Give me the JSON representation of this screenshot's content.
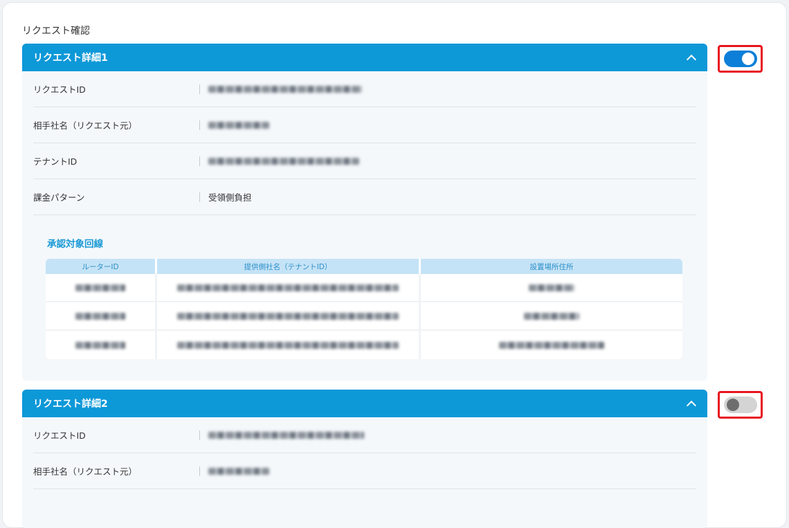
{
  "page": {
    "title": "リクエスト確認"
  },
  "requests": [
    {
      "header": "リクエスト詳細1",
      "toggle_on": true,
      "fields": [
        {
          "label": "リクエストID",
          "value": ""
        },
        {
          "label": "相手社名（リクエスト元）",
          "value": ""
        },
        {
          "label": "テナントID",
          "value": ""
        },
        {
          "label": "課金パターン",
          "value": "受領側負担"
        }
      ],
      "lines_title": "承認対象回線",
      "table": {
        "headers": [
          "ルーターID",
          "提供側社名（テナントID）",
          "設置場所住所"
        ],
        "rows": [
          [
            "",
            "",
            ""
          ],
          [
            "",
            "",
            ""
          ],
          [
            "",
            "",
            ""
          ]
        ]
      }
    },
    {
      "header": "リクエスト詳細2",
      "toggle_on": false,
      "fields": [
        {
          "label": "リクエストID",
          "value": ""
        },
        {
          "label": "相手社名（リクエスト元）",
          "value": ""
        }
      ]
    }
  ],
  "colors": {
    "header_blue": "#0d98d8",
    "toggle_on": "#0d7fd8",
    "highlight_red": "#e8141e"
  }
}
